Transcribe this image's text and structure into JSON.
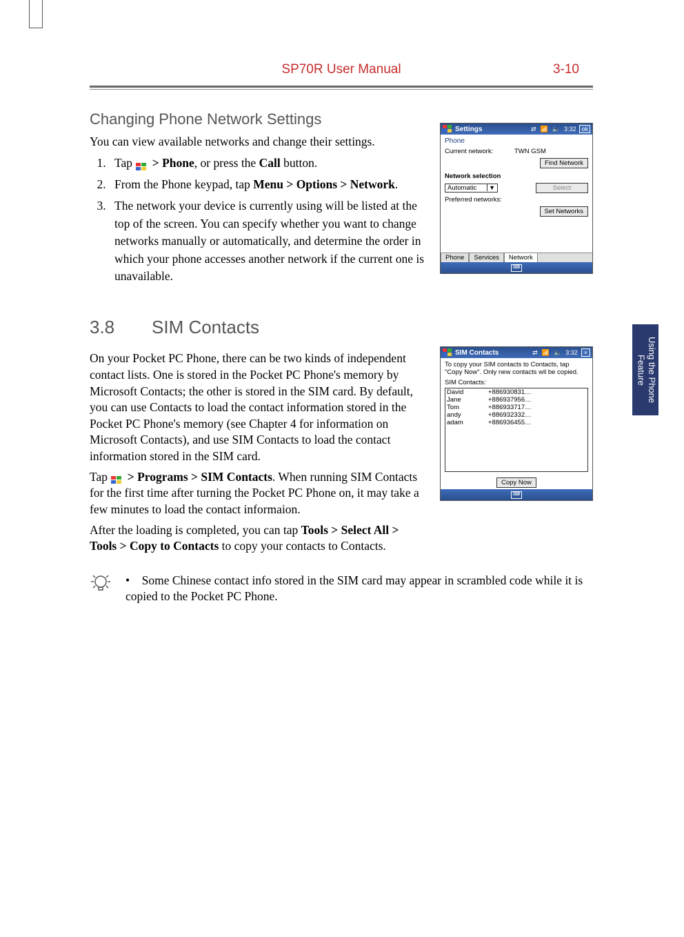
{
  "header": {
    "title": "SP70R User Manual",
    "page_num": "3-10"
  },
  "side_tab": "Using the Phone Feature",
  "section_changing": {
    "heading": "Changing Phone Network Settings",
    "intro": "You can view available networks and change their settings.",
    "step1_prefix": "Tap ",
    "step1_bold1": "> Phone",
    "step1_mid": ", or press the ",
    "step1_bold2": "Call",
    "step1_suffix": " button.",
    "step2_prefix": "From the Phone keypad, tap ",
    "step2_bold": "Menu > Options > Network",
    "step2_suffix": ".",
    "step3": "The network your device is currently using will be listed at the top of the screen. You can specify whether you want to change networks manually or automatically, and determine the order in which your phone accesses another network if the current one is unavailable."
  },
  "screenshot_settings": {
    "title": "Settings",
    "time": "3:32",
    "ok": "ok",
    "subtitle": "Phone",
    "current_network_label": "Current network:",
    "current_network_value": "TWN GSM",
    "find_network_btn": "Find Network",
    "network_selection_label": "Network selection",
    "selection_value": "Automatic",
    "select_btn": "Select",
    "preferred_label": "Preferred networks:",
    "set_networks_btn": "Set Networks",
    "tabs": [
      "Phone",
      "Services",
      "Network"
    ]
  },
  "section_sim": {
    "number": "3.8",
    "title": "SIM Contacts",
    "p1": "On your Pocket PC Phone, there can be two kinds of independent contact lists. One is stored in the Pocket PC Phone's memory by Microsoft Contacts; the other is stored in the SIM card. By default, you can use Contacts to load the contact information stored in the Pocket PC Phone's memory (see Chapter 4 for information on Microsoft Contacts), and use SIM Contacts to load the contact information stored in the SIM card.",
    "p2_prefix": "Tap ",
    "p2_bold": "> Programs > SIM Contacts",
    "p2_suffix": ". When running SIM Contacts for the first time after turning the Pocket PC Phone on, it may take a few minutes to load the contact informaion.",
    "p3_prefix": "After the loading is completed, you can tap ",
    "p3_bold": "Tools > Select All > Tools > Copy to Contacts",
    "p3_suffix": " to copy your contacts to Contacts.",
    "tip": "Some Chinese contact info stored in the SIM card may appear in scrambled code while it is copied to the Pocket PC Phone."
  },
  "screenshot_sim": {
    "title": "SIM Contacts",
    "time": "3:32",
    "instruction": "To copy your SIM contacts to Contacts, tap \"Copy Now\". Only new contacts wil be copied.",
    "list_label": "SIM Contacts:",
    "contacts": [
      {
        "name": "David",
        "phone": "+886930831…"
      },
      {
        "name": "Jane",
        "phone": "+886937956…"
      },
      {
        "name": "Tom",
        "phone": "+886933717…"
      },
      {
        "name": "andy",
        "phone": "+886932332…"
      },
      {
        "name": "adam",
        "phone": "+886936455…"
      }
    ],
    "copy_btn": "Copy Now"
  }
}
